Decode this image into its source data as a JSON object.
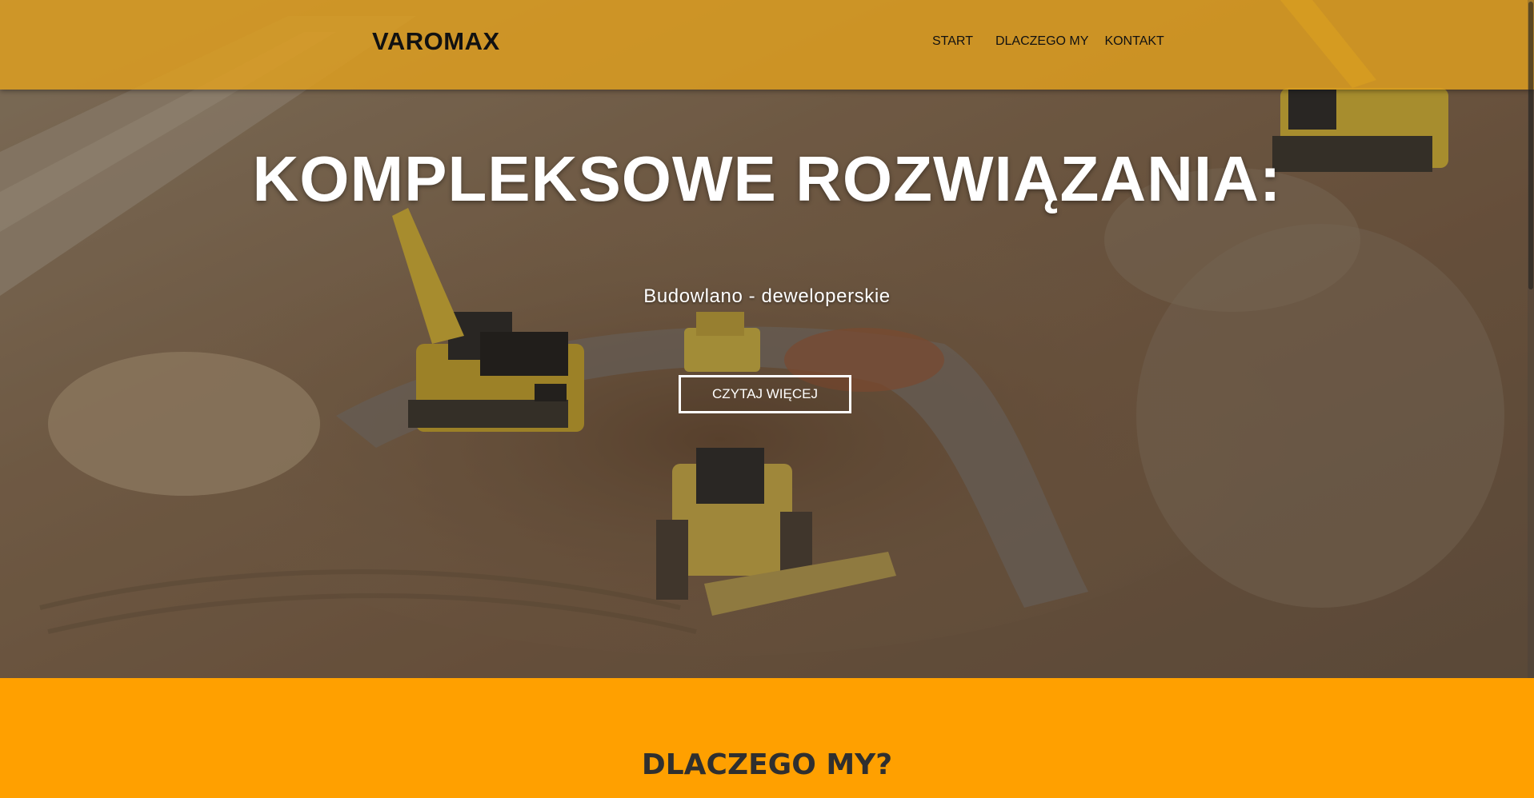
{
  "header": {
    "logo": "VAROMAX",
    "nav": [
      {
        "label": "START"
      },
      {
        "label": "DLACZEGO MY"
      },
      {
        "label": "KONTAKT"
      }
    ]
  },
  "hero": {
    "headline": "KOMPLEKSOWE ROZWIĄZANIA:",
    "subheadline": "Budowlano - deweloperskie",
    "cta_label": "CZYTAJ WIĘCEJ"
  },
  "section": {
    "title": "DLACZEGO MY?"
  },
  "colors": {
    "accent": "#ffa000",
    "header_bg": "#e0a01e",
    "text_dark": "#111111",
    "section_title": "#2f2f2f",
    "hero_text": "#ffffff"
  }
}
